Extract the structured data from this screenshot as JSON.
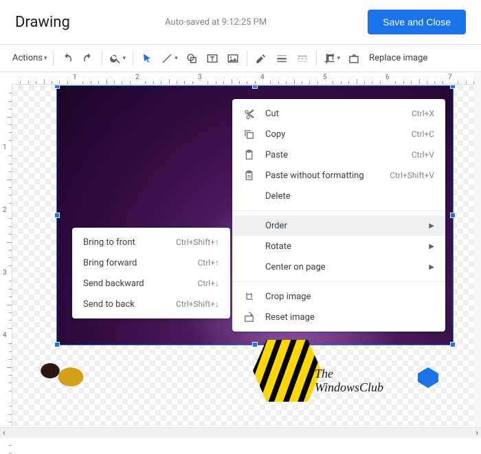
{
  "header": {
    "title": "Drawing",
    "autosave": "Auto-saved at 9:12:25 PM",
    "save_button": "Save and Close"
  },
  "toolbar": {
    "actions": "Actions",
    "replace_image": "Replace image"
  },
  "ruler": {
    "h": [
      "1",
      "2",
      "3",
      "4",
      "5",
      "6",
      "7"
    ],
    "v": [
      "1",
      "2",
      "3",
      "4"
    ]
  },
  "context_menu": {
    "cut": {
      "label": "Cut",
      "shortcut": "Ctrl+X"
    },
    "copy": {
      "label": "Copy",
      "shortcut": "Ctrl+C"
    },
    "paste": {
      "label": "Paste",
      "shortcut": "Ctrl+V"
    },
    "paste_nofmt": {
      "label": "Paste without formatting",
      "shortcut": "Ctrl+Shift+V"
    },
    "delete": {
      "label": "Delete"
    },
    "order": {
      "label": "Order"
    },
    "rotate": {
      "label": "Rotate"
    },
    "center": {
      "label": "Center on page"
    },
    "crop": {
      "label": "Crop image"
    },
    "reset": {
      "label": "Reset image"
    }
  },
  "order_submenu": {
    "front": {
      "label": "Bring to front",
      "shortcut": "Ctrl+Shift+↑"
    },
    "forward": {
      "label": "Bring forward",
      "shortcut": "Ctrl+↑"
    },
    "backward": {
      "label": "Send backward",
      "shortcut": "Ctrl+↓"
    },
    "back": {
      "label": "Send to back",
      "shortcut": "Ctrl+Shift+↓"
    }
  },
  "watermark": {
    "line1": "The",
    "line2": "WindowsClub"
  }
}
